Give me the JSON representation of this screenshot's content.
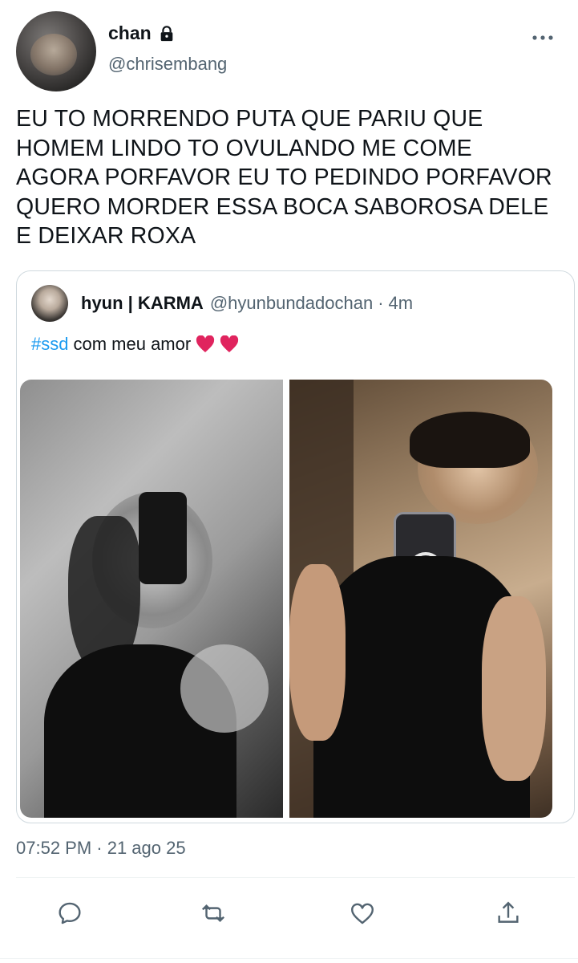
{
  "author": {
    "display_name": "chan",
    "handle": "@chrisembang",
    "protected": true,
    "lock_icon": "lock-icon"
  },
  "tweet": {
    "text": "EU TO MORRENDO PUTA QUE PARIU QUE\nHOMEM LINDO TO OVULANDO ME COME\nAGORA PORFAVOR EU TO PEDINDO PORFAVOR\nQUERO MORDER ESSA BOCA SABOROSA DELE\nE DEIXAR ROXA",
    "timestamp": "07:52 PM · 21 ago 25"
  },
  "quoted_tweet": {
    "display_name": "hyun | KARMA",
    "handle": "@hyunbundadochan",
    "separator": "·",
    "relative_time": "4m",
    "hashtag": "#ssd",
    "text": "com meu amor",
    "emoji_icons": [
      "red-heart-icon",
      "red-heart-icon"
    ],
    "media_count": 2
  },
  "actions": [
    {
      "name": "reply",
      "icon": "reply-icon"
    },
    {
      "name": "retweet",
      "icon": "retweet-icon"
    },
    {
      "name": "like",
      "icon": "heart-outline-icon"
    },
    {
      "name": "share",
      "icon": "share-icon"
    }
  ],
  "colors": {
    "text": "#0f1419",
    "secondary": "#536471",
    "link": "#1d9bf0",
    "border": "#cfd9de",
    "heart": "#e0245e"
  }
}
